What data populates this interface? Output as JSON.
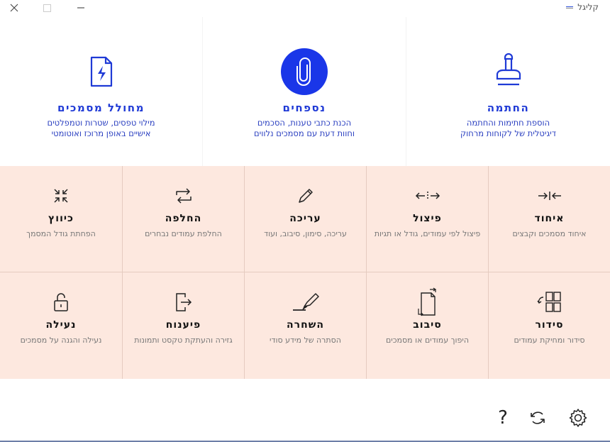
{
  "window": {
    "title": "קליגל",
    "icons": {
      "close": "close-icon",
      "maximize": "maximize-icon",
      "minimize": "minimize-icon"
    }
  },
  "featured": [
    {
      "key": "signing",
      "title": "החתמה",
      "desc_line1": "הוספת חתימות והחתמה",
      "desc_line2": "דיגיטלית של לקוחות מרחוק",
      "icon": "stamp-icon"
    },
    {
      "key": "attachments",
      "title": "נספחים",
      "desc_line1": "הכנת כתבי טענות, הסכמים",
      "desc_line2": "וחוות דעת עם מסמכים נלווים",
      "icon": "paperclip-icon"
    },
    {
      "key": "generator",
      "title": "מחולל מסמכים",
      "desc_line1": "מילוי טפסים, שטרות וטמפלטים",
      "desc_line2": "אישיים באופן מרוכז ואוטומטי",
      "icon": "lightning-document-icon"
    }
  ],
  "tools_row1": [
    {
      "key": "merge",
      "title": "איחוד",
      "desc": "איחוד מסמכים וקבצים",
      "icon": "merge-arrows-icon"
    },
    {
      "key": "split",
      "title": "פיצול",
      "desc": "פיצול לפי עמודים, גודל או תגיות",
      "icon": "split-arrows-icon"
    },
    {
      "key": "edit",
      "title": "עריכה",
      "desc": "עריכה, סימון, סיבוב, ועוד",
      "icon": "pencil-icon"
    },
    {
      "key": "replace",
      "title": "החלפה",
      "desc": "החלפת עמודים נבחרים",
      "icon": "swap-icon"
    },
    {
      "key": "compress",
      "title": "כיווץ",
      "desc": "הפחתת גודל המסמך",
      "icon": "compress-icon"
    }
  ],
  "tools_row2": [
    {
      "key": "arrange",
      "title": "סידור",
      "desc": "סידור ומחיקת עמודים",
      "icon": "grid-arrange-icon"
    },
    {
      "key": "rotate",
      "title": "סיבוב",
      "desc": "היפוך עמודים או מסמכים",
      "icon": "rotate-pages-icon"
    },
    {
      "key": "redact",
      "title": "השחרה",
      "desc": "הסתרה של מידע סודי",
      "icon": "marker-icon"
    },
    {
      "key": "ocr",
      "title": "פיענוח",
      "desc": "גזירה והעתקת טקסט ותמונות",
      "icon": "export-document-icon"
    },
    {
      "key": "lock",
      "title": "נעילה",
      "desc": "נעילה והגנה על מסמכים",
      "icon": "lock-icon"
    }
  ],
  "bottom": {
    "help_label": "?",
    "icons": {
      "refresh": "refresh-icon",
      "settings": "gear-icon"
    }
  },
  "colors": {
    "accent": "#1f3ad6",
    "featured_circle": "#1a36e8",
    "tile_background": "#fde8df",
    "tile_desc": "#777777"
  }
}
